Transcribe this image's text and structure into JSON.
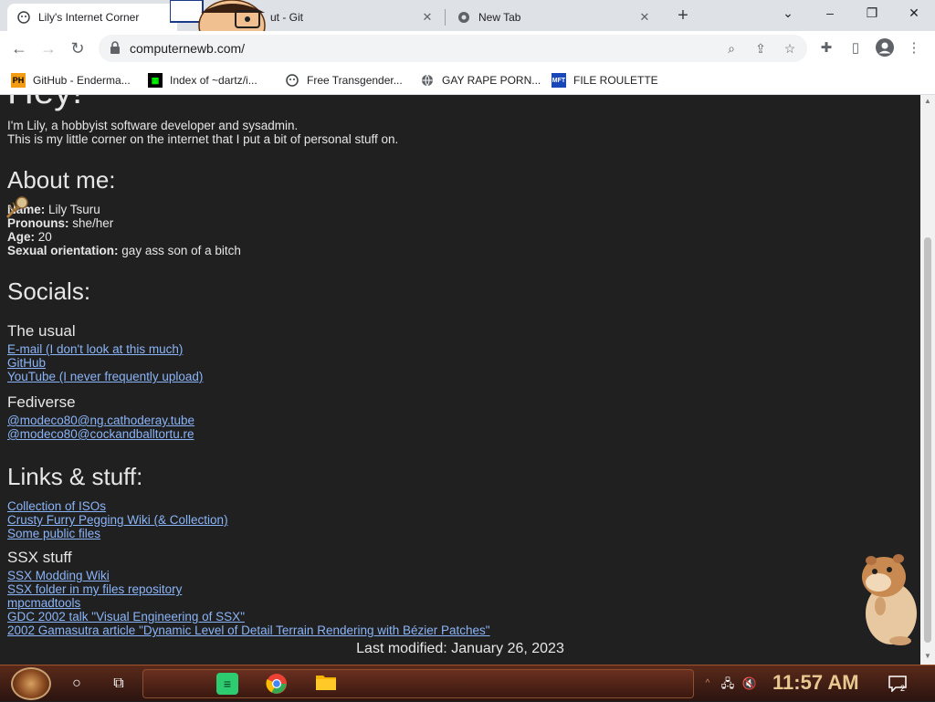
{
  "browser": {
    "tabs": [
      {
        "title": "Lily's Internet Corner",
        "active": true
      },
      {
        "title": "ut - Git",
        "active": false
      },
      {
        "title": "New Tab",
        "active": false
      }
    ],
    "url": "computernewb.com/",
    "url_hidden_part": "/",
    "bookmarks": [
      {
        "label": "GitHub - Enderma...",
        "icon": "ph-icon"
      },
      {
        "label": "Index of ~dartz/i...",
        "icon": "maze-icon"
      },
      {
        "label": "Free Transgender...",
        "icon": "mask-icon"
      },
      {
        "label": "GAY RAPE PORN...",
        "icon": "globe-icon"
      },
      {
        "label": "FILE ROULETTE",
        "icon": "mft-icon"
      }
    ]
  },
  "page": {
    "heading": "Hey!",
    "intro_line1": "I'm Lily, a hobbyist software developer and sysadmin.",
    "intro_line2": "This is my little corner on the internet that I put a bit of personal stuff on.",
    "about_title": "About me:",
    "about": [
      {
        "label": "Name:",
        "value": "Lily Tsuru"
      },
      {
        "label": "Pronouns:",
        "value": "she/her"
      },
      {
        "label": "Age:",
        "value": "20"
      },
      {
        "label": "Sexual orientation:",
        "value": "gay ass son of a bitch"
      }
    ],
    "socials_title": "Socials:",
    "usual_title": "The usual",
    "usual_links": [
      "E-mail (I don't look at this much)",
      "GitHub",
      "YouTube (I never frequently upload)"
    ],
    "fediverse_title": "Fediverse",
    "fediverse_links": [
      "@modeco80@ng.cathoderay.tube",
      "@modeco80@cockandballtortu.re"
    ],
    "links_title": "Links & stuff:",
    "links": [
      "Collection of ISOs",
      "Crusty Furry Pegging Wiki (& Collection)",
      "Some public files"
    ],
    "ssx_title": "SSX stuff",
    "ssx_links": [
      "SSX Modding Wiki",
      "SSX folder in my files repository",
      "mpcmadtools",
      "GDC 2002 talk \"Visual Engineering of SSX\"",
      "2002 Gamasutra article \"Dynamic Level of Detail Terrain Rendering with Bézier Patches\""
    ],
    "last_modified": "Last modified: January 26, 2023"
  },
  "taskbar": {
    "clock": "11:57 AM",
    "notification_count": "2"
  },
  "colors": {
    "page_bg": "#202020",
    "text": "#e6e6e6",
    "link": "#8ab4f8"
  }
}
